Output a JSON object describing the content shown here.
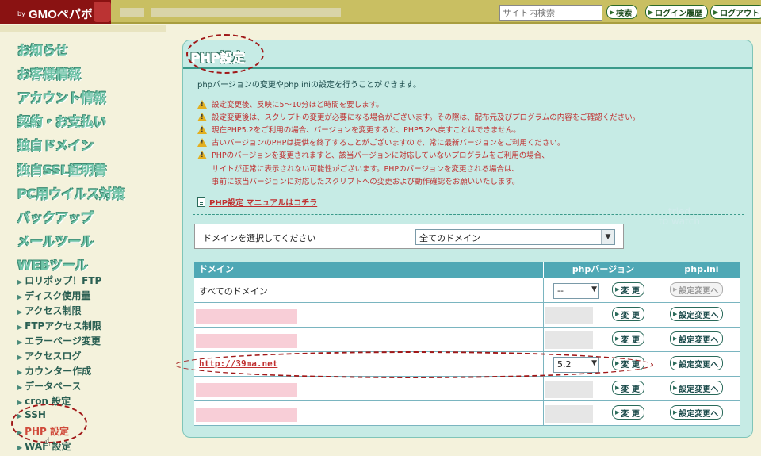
{
  "header": {
    "logo_by": "by",
    "logo_text": "GMOペパボ",
    "search_placeholder": "サイト内検索",
    "search_button": "検索",
    "login_history_button": "ログイン履歴",
    "logout_button": "ログアウト"
  },
  "sidebar": {
    "main_items": [
      "お知らせ",
      "お客様情報",
      "アカウント情報",
      "契約・お支払い",
      "独自ドメイン",
      "独自SSL証明書",
      "PC用ウイルス対策",
      "バックアップ",
      "メールツール",
      "WEBツール"
    ],
    "sub_items": [
      "ロリポップ！FTP",
      "ディスク使用量",
      "アクセス制限",
      "FTPアクセス制限",
      "エラーページ変更",
      "アクセスログ",
      "カウンター作成",
      "データベース",
      "cron 設定",
      "SSH",
      "PHP 設定",
      "WAF 設定"
    ],
    "active_item": "PHP 設定"
  },
  "panel": {
    "title": "PHP設定",
    "intro": "phpバージョンの変更やphp.iniの設定を行うことができます。",
    "warnings": [
      "設定変更後、反映に5～10分ほど時間を要します。",
      "設定変更後は、スクリプトの変更が必要になる場合がございます。その際は、配布元及びプログラムの内容をご確認ください。",
      "現在PHP5.2をご利用の場合、バージョンを変更すると、PHP5.2へ戻すことはできません。",
      "古いバージョンのPHPは提供を終了することがございますので、常に最新バージョンをご利用ください。",
      "PHPのバージョンを変更されますと、該当バージョンに対応していないプログラムをご利用の場合、"
    ],
    "warning_continuation": [
      "サイトが正常に表示されない可能性がございます。PHPのバージョンを変更される場合は、",
      "事前に該当バージョンに対応したスクリプトへの変更および動作確認をお願いいたします。"
    ],
    "manual_link": "PHP設定 マニュアルはコチラ",
    "watermark": [
      "tried",
      "to watch"
    ],
    "domain_select": {
      "label": "ドメインを選択してください",
      "value": "全てのドメイン"
    },
    "table": {
      "headers": [
        "ドメイン",
        "phpバージョン",
        "php.ini"
      ],
      "rows": [
        {
          "domain": "すべてのドメイン",
          "version": "--",
          "change": "変 更",
          "ini": "設定変更へ",
          "ini_disabled": true
        },
        {
          "domain": "",
          "version": "",
          "change": "変 更",
          "ini": "設定変更へ",
          "ini_disabled": false
        },
        {
          "domain": "",
          "version": "",
          "change": "変 更",
          "ini": "設定変更へ",
          "ini_disabled": false
        },
        {
          "domain": "http://39ma.net",
          "version": "5.2",
          "change": "変 更",
          "ini": "設定変更へ",
          "ini_disabled": false
        },
        {
          "domain": "",
          "version": "",
          "change": "変 更",
          "ini": "設定変更へ",
          "ini_disabled": false
        },
        {
          "domain": "",
          "version": "",
          "change": "変 更",
          "ini": "設定変更へ",
          "ini_disabled": false
        }
      ]
    }
  }
}
